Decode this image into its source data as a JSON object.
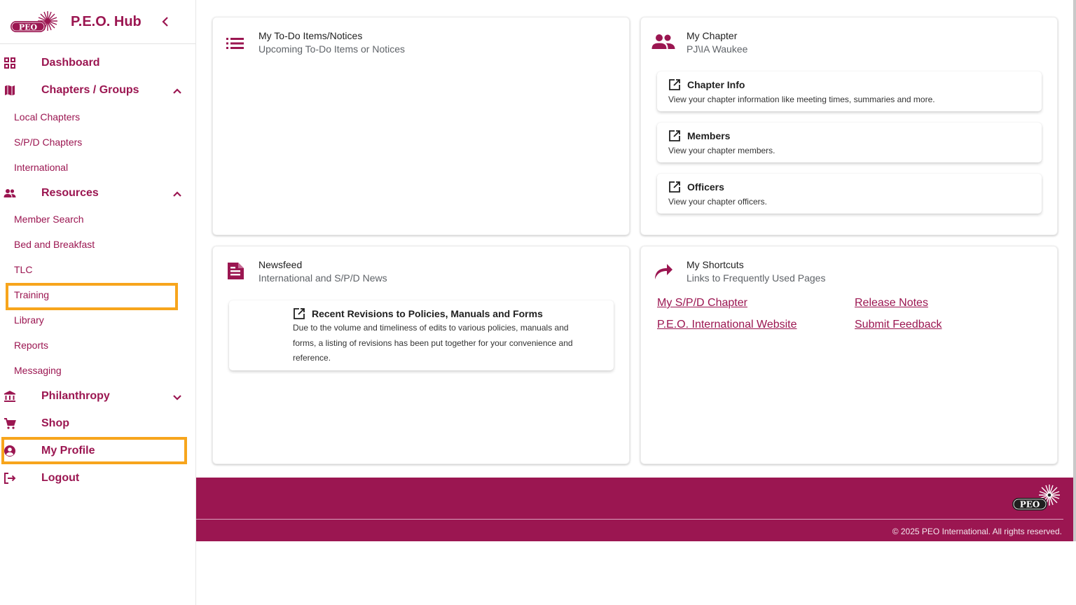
{
  "sidebar": {
    "brand_title": "P.E.O. Hub",
    "logo_text": "PEO",
    "nav": {
      "dashboard": "Dashboard",
      "chapters_groups": "Chapters / Groups",
      "local_chapters": "Local Chapters",
      "spd_chapters": "S/P/D Chapters",
      "international": "International",
      "resources": "Resources",
      "member_search": "Member Search",
      "bed_breakfast": "Bed and Breakfast",
      "tlc": "TLC",
      "training": "Training",
      "library": "Library",
      "reports": "Reports",
      "messaging": "Messaging",
      "philanthropy": "Philanthropy",
      "shop": "Shop",
      "my_profile": "My Profile",
      "logout": "Logout"
    }
  },
  "todo": {
    "title": "My To-Do Items/Notices",
    "subtitle": "Upcoming To-Do Items or Notices"
  },
  "chapter": {
    "title": "My Chapter",
    "subtitle": "PJ\\IA Waukee",
    "tiles": [
      {
        "title": "Chapter Info",
        "desc": "View your chapter information like meeting times, summaries and more."
      },
      {
        "title": "Members",
        "desc": "View your chapter members."
      },
      {
        "title": "Officers",
        "desc": "View your chapter officers."
      }
    ]
  },
  "newsfeed": {
    "title": "Newsfeed",
    "subtitle": "International and S/P/D News",
    "item": {
      "title": "Recent Revisions to Policies, Manuals and Forms",
      "desc": "Due to the volume and timeliness of edits to various policies, manuals and forms, a listing of revisions has been put together for your convenience and reference."
    }
  },
  "shortcuts": {
    "title": "My Shortcuts",
    "subtitle": "Links to Frequently Used Pages",
    "links": [
      "My S/P/D Chapter",
      "Release Notes",
      "P.E.O. International Website",
      "Submit Feedback"
    ]
  },
  "footer": {
    "logo_text": "PEO",
    "copyright": "© 2025 PEO International. All rights reserved."
  },
  "colors": {
    "brand": "#9b1651",
    "highlight": "#f7a51c",
    "footer_bg": "#9b1651"
  },
  "icons": [
    "chevron-left-icon",
    "dashboard-icon",
    "map-icon",
    "chevron-up-icon",
    "people-icon",
    "bank-icon",
    "cart-icon",
    "account-circle-icon",
    "logout-icon",
    "list-icon",
    "document-icon",
    "share-arrow-icon",
    "open-external-icon"
  ]
}
